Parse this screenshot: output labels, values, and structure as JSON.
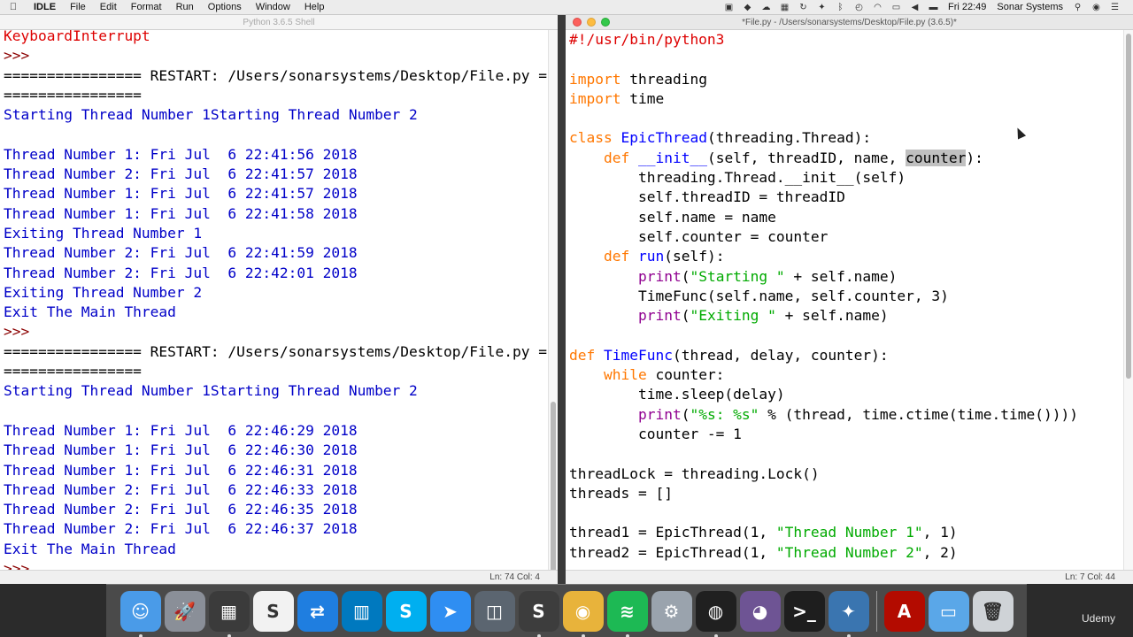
{
  "menubar": {
    "app_name": "IDLE",
    "menus": [
      "File",
      "Edit",
      "Format",
      "Run",
      "Options",
      "Window",
      "Help"
    ],
    "clock": "Fri 22:49",
    "user": "Sonar Systems"
  },
  "shell": {
    "title": "Python 3.6.5 Shell",
    "status": "Ln: 74   Col: 4",
    "lines": [
      {
        "type": "com",
        "text": "KeyboardInterrupt"
      },
      {
        "type": "prompt",
        "text": ">>> "
      },
      {
        "type": "plain",
        "text": "================ RESTART: /Users/sonarsystems/Desktop/File.py ="
      },
      {
        "type": "plain",
        "text": "================"
      },
      {
        "type": "out",
        "text": "Starting Thread Number 1Starting Thread Number 2"
      },
      {
        "type": "out",
        "text": ""
      },
      {
        "type": "out",
        "text": "Thread Number 1: Fri Jul  6 22:41:56 2018"
      },
      {
        "type": "out",
        "text": "Thread Number 2: Fri Jul  6 22:41:57 2018"
      },
      {
        "type": "out",
        "text": "Thread Number 1: Fri Jul  6 22:41:57 2018"
      },
      {
        "type": "out",
        "text": "Thread Number 1: Fri Jul  6 22:41:58 2018"
      },
      {
        "type": "out",
        "text": "Exiting Thread Number 1"
      },
      {
        "type": "out",
        "text": "Thread Number 2: Fri Jul  6 22:41:59 2018"
      },
      {
        "type": "out",
        "text": "Thread Number 2: Fri Jul  6 22:42:01 2018"
      },
      {
        "type": "out",
        "text": "Exiting Thread Number 2"
      },
      {
        "type": "out",
        "text": "Exit The Main Thread"
      },
      {
        "type": "prompt",
        "text": ">>> "
      },
      {
        "type": "plain",
        "text": "================ RESTART: /Users/sonarsystems/Desktop/File.py ="
      },
      {
        "type": "plain",
        "text": "================"
      },
      {
        "type": "out",
        "text": "Starting Thread Number 1Starting Thread Number 2"
      },
      {
        "type": "out",
        "text": ""
      },
      {
        "type": "out",
        "text": "Thread Number 1: Fri Jul  6 22:46:29 2018"
      },
      {
        "type": "out",
        "text": "Thread Number 1: Fri Jul  6 22:46:30 2018"
      },
      {
        "type": "out",
        "text": "Thread Number 1: Fri Jul  6 22:46:31 2018"
      },
      {
        "type": "out",
        "text": "Thread Number 2: Fri Jul  6 22:46:33 2018"
      },
      {
        "type": "out",
        "text": "Thread Number 2: Fri Jul  6 22:46:35 2018"
      },
      {
        "type": "out",
        "text": "Thread Number 2: Fri Jul  6 22:46:37 2018"
      },
      {
        "type": "out",
        "text": "Exit The Main Thread"
      },
      {
        "type": "prompt",
        "text": ">>> "
      }
    ]
  },
  "editor": {
    "title": "*File.py - /Users/sonarsystems/Desktop/File.py (3.6.5)*",
    "status": "Ln: 7   Col: 44",
    "lines": [
      [
        {
          "c": "com",
          "t": "#!/usr/bin/python3"
        }
      ],
      [],
      [
        {
          "c": "kw",
          "t": "import"
        },
        {
          "c": "",
          "t": " threading"
        }
      ],
      [
        {
          "c": "kw",
          "t": "import"
        },
        {
          "c": "",
          "t": " time"
        }
      ],
      [],
      [
        {
          "c": "kw",
          "t": "class"
        },
        {
          "c": "",
          "t": " "
        },
        {
          "c": "def",
          "t": "EpicThread"
        },
        {
          "c": "",
          "t": "(threading.Thread):"
        }
      ],
      [
        {
          "c": "",
          "t": "    "
        },
        {
          "c": "kw",
          "t": "def"
        },
        {
          "c": "",
          "t": " "
        },
        {
          "c": "def",
          "t": "__init__"
        },
        {
          "c": "",
          "t": "(self, threadID, name, "
        },
        {
          "c": "hl",
          "t": "counter"
        },
        {
          "c": "",
          "t": "):"
        }
      ],
      [
        {
          "c": "",
          "t": "        threading.Thread.__init__(self)"
        }
      ],
      [
        {
          "c": "",
          "t": "        self.threadID = threadID"
        }
      ],
      [
        {
          "c": "",
          "t": "        self.name = name"
        }
      ],
      [
        {
          "c": "",
          "t": "        self.counter = counter"
        }
      ],
      [
        {
          "c": "",
          "t": "    "
        },
        {
          "c": "kw",
          "t": "def"
        },
        {
          "c": "",
          "t": " "
        },
        {
          "c": "def",
          "t": "run"
        },
        {
          "c": "",
          "t": "(self):"
        }
      ],
      [
        {
          "c": "",
          "t": "        "
        },
        {
          "c": "bi",
          "t": "print"
        },
        {
          "c": "",
          "t": "("
        },
        {
          "c": "str",
          "t": "\"Starting \""
        },
        {
          "c": "",
          "t": " + self.name)"
        }
      ],
      [
        {
          "c": "",
          "t": "        TimeFunc(self.name, self.counter, 3)"
        }
      ],
      [
        {
          "c": "",
          "t": "        "
        },
        {
          "c": "bi",
          "t": "print"
        },
        {
          "c": "",
          "t": "("
        },
        {
          "c": "str",
          "t": "\"Exiting \""
        },
        {
          "c": "",
          "t": " + self.name)"
        }
      ],
      [],
      [
        {
          "c": "kw",
          "t": "def"
        },
        {
          "c": "",
          "t": " "
        },
        {
          "c": "def",
          "t": "TimeFunc"
        },
        {
          "c": "",
          "t": "(thread, delay, counter):"
        }
      ],
      [
        {
          "c": "",
          "t": "    "
        },
        {
          "c": "kw",
          "t": "while"
        },
        {
          "c": "",
          "t": " counter:"
        }
      ],
      [
        {
          "c": "",
          "t": "        time.sleep(delay)"
        }
      ],
      [
        {
          "c": "",
          "t": "        "
        },
        {
          "c": "bi",
          "t": "print"
        },
        {
          "c": "",
          "t": "("
        },
        {
          "c": "str",
          "t": "\"%s: %s\""
        },
        {
          "c": "",
          "t": " % (thread, time.ctime(time.time())))"
        }
      ],
      [
        {
          "c": "",
          "t": "        counter -= 1"
        }
      ],
      [],
      [
        {
          "c": "",
          "t": "threadLock = threading.Lock()"
        }
      ],
      [
        {
          "c": "",
          "t": "threads = []"
        }
      ],
      [],
      [
        {
          "c": "",
          "t": "thread1 = EpicThread(1, "
        },
        {
          "c": "str",
          "t": "\"Thread Number 1\""
        },
        {
          "c": "",
          "t": ", 1)"
        }
      ],
      [
        {
          "c": "",
          "t": "thread2 = EpicThread(1, "
        },
        {
          "c": "str",
          "t": "\"Thread Number 2\""
        },
        {
          "c": "",
          "t": ", 2)"
        }
      ]
    ]
  },
  "dock": {
    "items": [
      {
        "name": "finder-icon",
        "color": "#4a9be8",
        "glyph": "☺",
        "running": true
      },
      {
        "name": "launchpad-icon",
        "color": "#8a8f98",
        "glyph": "🚀",
        "running": false
      },
      {
        "name": "screen-tool-icon",
        "color": "#3b3b3b",
        "glyph": "▦",
        "running": true
      },
      {
        "name": "scrivener-icon",
        "color": "#f2f2f2",
        "glyph": "S",
        "running": false
      },
      {
        "name": "teamviewer-icon",
        "color": "#1f7ee0",
        "glyph": "⇄",
        "running": false
      },
      {
        "name": "trello-icon",
        "color": "#0079bf",
        "glyph": "▥",
        "running": false
      },
      {
        "name": "skype-icon",
        "color": "#00aff0",
        "glyph": "S",
        "running": false
      },
      {
        "name": "send-icon",
        "color": "#2f8ef2",
        "glyph": "➤",
        "running": false
      },
      {
        "name": "xcode-window-icon",
        "color": "#5b6570",
        "glyph": "◫",
        "running": false
      },
      {
        "name": "sublime-icon",
        "color": "#3d3d3d",
        "glyph": "S",
        "running": true
      },
      {
        "name": "chrome-icon",
        "color": "#e8b33b",
        "glyph": "◉",
        "running": true
      },
      {
        "name": "spotify-icon",
        "color": "#1db954",
        "glyph": "≋",
        "running": true
      },
      {
        "name": "system-preferences-icon",
        "color": "#9aa3ad",
        "glyph": "⚙",
        "running": false
      },
      {
        "name": "obs-icon",
        "color": "#202020",
        "glyph": "◍",
        "running": true
      },
      {
        "name": "github-icon",
        "color": "#6e5494",
        "glyph": "◕",
        "running": false
      },
      {
        "name": "terminal-icon",
        "color": "#1e1e1e",
        "glyph": ">_",
        "running": false
      },
      {
        "name": "python-launcher-icon",
        "color": "#3a75b0",
        "glyph": "✦",
        "running": true
      },
      {
        "name": "acrobat-icon",
        "color": "#b30b00",
        "glyph": "A",
        "running": false
      },
      {
        "name": "folder-icon",
        "color": "#5aa7e8",
        "glyph": "▭",
        "running": false
      },
      {
        "name": "trash-icon",
        "color": "#cfd3d7",
        "glyph": "🗑",
        "running": false
      }
    ]
  },
  "watermark": "Udemy"
}
